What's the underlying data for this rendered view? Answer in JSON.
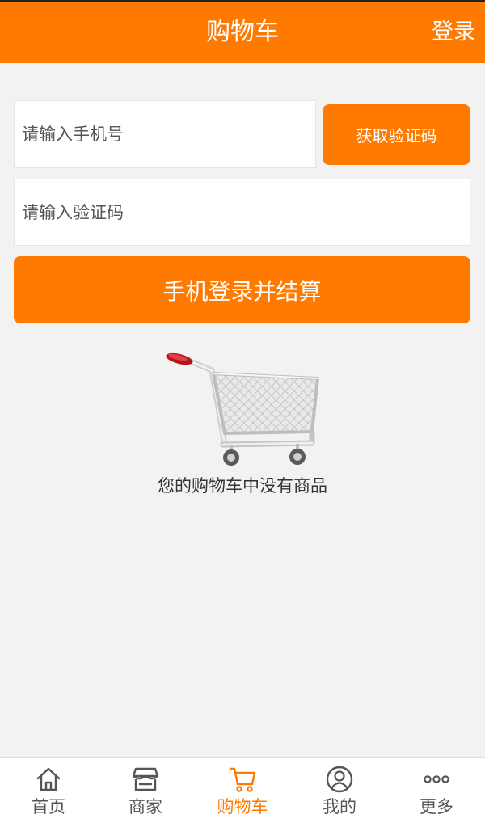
{
  "header": {
    "title": "购物车",
    "login_label": "登录"
  },
  "form": {
    "phone_placeholder": "请输入手机号",
    "code_placeholder": "请输入验证码",
    "get_code_label": "获取验证码",
    "submit_label": "手机登录并结算"
  },
  "empty_cart": {
    "message": "您的购物车中没有商品",
    "icon": "shopping-cart-icon"
  },
  "tabbar": {
    "items": [
      {
        "label": "首页",
        "icon": "home-icon",
        "active": false
      },
      {
        "label": "商家",
        "icon": "store-icon",
        "active": false
      },
      {
        "label": "购物车",
        "icon": "cart-icon",
        "active": true
      },
      {
        "label": "我的",
        "icon": "user-icon",
        "active": false
      },
      {
        "label": "更多",
        "icon": "more-icon",
        "active": false
      }
    ]
  },
  "colors": {
    "accent": "#ff7a00",
    "background": "#f2f2f2",
    "tab_inactive": "#555555"
  }
}
